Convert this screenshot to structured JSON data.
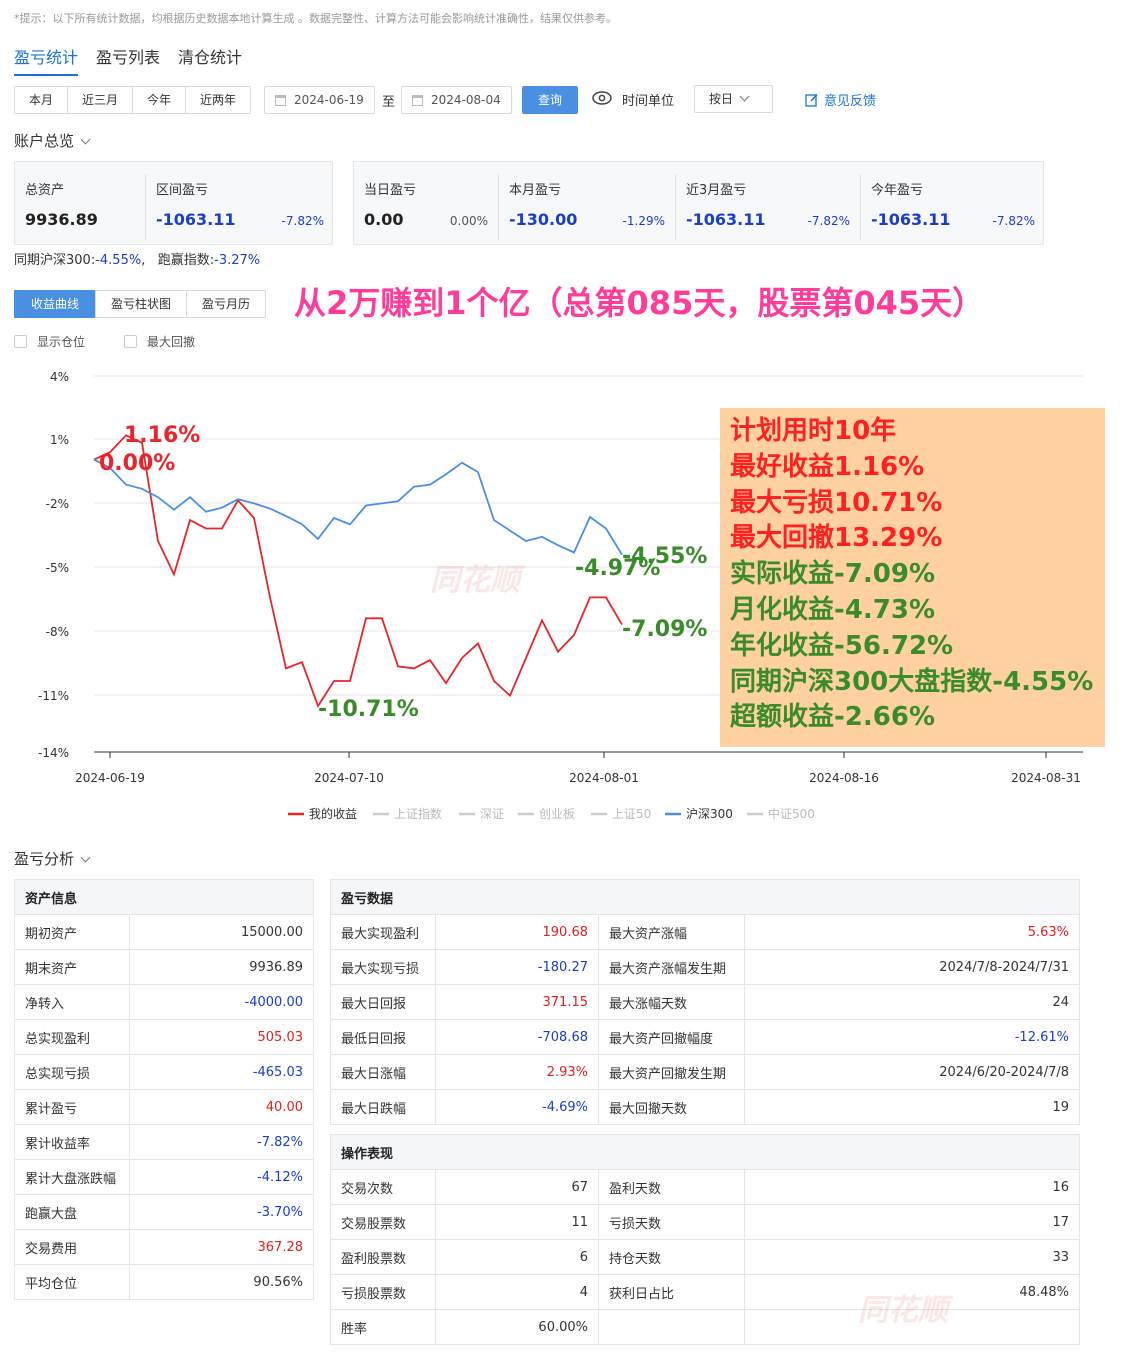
{
  "notice": "*提示：以下所有统计数据，均根据历史数据本地计算生成 。数据完整性、计算方法可能会影响统计准确性，结果仅供参考。",
  "tabs": [
    "盈亏统计",
    "盈亏列表",
    "清仓统计"
  ],
  "periods": [
    "本月",
    "近三月",
    "今年",
    "近两年"
  ],
  "filter": {
    "start_date": "2024-06-19",
    "to": "至",
    "end_date": "2024-08-04",
    "query": "查询",
    "time_unit_label": "时间单位",
    "time_unit_value": "按日",
    "feedback": "意见反馈"
  },
  "overview": {
    "title": "账户总览",
    "total_assets_label": "总资产",
    "total_assets": "9936.89",
    "range_pl_label": "区间盈亏",
    "range_pl": "-1063.11",
    "range_pl_pct": "-7.82%",
    "day_pl_label": "当日盈亏",
    "day_pl": "0.00",
    "day_pl_pct": "0.00%",
    "month_pl_label": "本月盈亏",
    "month_pl": "-130.00",
    "month_pl_pct": "-1.29%",
    "q3_pl_label": "近3月盈亏",
    "q3_pl": "-1063.11",
    "q3_pl_pct": "-7.82%",
    "year_pl_label": "今年盈亏",
    "year_pl": "-1063.11",
    "year_pl_pct": "-7.82%",
    "compare_hs300_label": "同期沪深300:",
    "compare_hs300": "-4.55%",
    "beat_label": "跑赢指数:",
    "beat": "-3.27%"
  },
  "chart_tabs": [
    "收益曲线",
    "盈亏柱状图",
    "盈亏月历"
  ],
  "headline": "从2万赚到1个亿（总第085天，股票第045天）",
  "checkboxes": [
    "显示仓位",
    "最大回撤"
  ],
  "info_lines": [
    {
      "text": "计划用时10年",
      "color": "#ff2020"
    },
    {
      "text": "最好收益1.16%",
      "color": "#ff2020"
    },
    {
      "text": "最大亏损10.71%",
      "color": "#ff2020"
    },
    {
      "text": "最大回撤13.29%",
      "color": "#ff2020"
    },
    {
      "text": "实际收益-7.09%",
      "color": "#3a8c2a"
    },
    {
      "text": "月化收益-4.73%",
      "color": "#3a8c2a"
    },
    {
      "text": "年化收益-56.72%",
      "color": "#3a8c2a"
    },
    {
      "text": "同期沪深300大盘指数-4.55%",
      "color": "#3a8c2a"
    },
    {
      "text": "超额收益-2.66%",
      "color": "#3a8c2a"
    }
  ],
  "chart_data": {
    "type": "line",
    "y_ticks": [
      "4%",
      "1%",
      "-2%",
      "-5%",
      "-8%",
      "-11%",
      "-14%"
    ],
    "ylim": [
      -14,
      4
    ],
    "x_ticks": [
      "2024-06-19",
      "2024-07-10",
      "2024-08-01",
      "2024-08-16",
      "2024-08-31"
    ],
    "series": [
      {
        "name": "我的收益",
        "color": "#e8252a",
        "values": [
          0.0,
          0.35,
          1.16,
          0.8,
          -3.9,
          -5.5,
          -2.9,
          -3.3,
          -3.3,
          -1.95,
          -2.8,
          -6.6,
          -10.0,
          -9.7,
          -11.8,
          -10.6,
          -10.6,
          -7.6,
          -7.6,
          -9.9,
          -10.0,
          -9.6,
          -10.7,
          -9.5,
          -8.8,
          -10.6,
          -11.3,
          -9.5,
          -7.7,
          -9.2,
          -8.4,
          -6.6,
          -6.6,
          -7.9
        ]
      },
      {
        "name": "沪深300",
        "color": "#4a90e2",
        "values": [
          0.0,
          -0.4,
          -1.2,
          -1.4,
          -1.8,
          -2.4,
          -1.8,
          -2.5,
          -2.3,
          -1.9,
          -2.1,
          -2.35,
          -2.7,
          -3.1,
          -3.8,
          -2.8,
          -3.1,
          -2.2,
          -2.1,
          -2.0,
          -1.3,
          -1.2,
          -0.7,
          -0.15,
          -0.6,
          -2.9,
          -3.4,
          -3.9,
          -3.7,
          -4.1,
          -4.45,
          -2.75,
          -3.3,
          -4.55
        ]
      }
    ],
    "annotations": [
      {
        "text": "1.16%",
        "color": "#e8252a"
      },
      {
        "text": "0.00%",
        "color": "#e8252a"
      },
      {
        "text": "-10.71%",
        "color": "#3a8c2a"
      },
      {
        "text": "-4.97%",
        "color": "#3a8c2a"
      },
      {
        "text": "-4.55%",
        "color": "#3a8c2a"
      },
      {
        "text": "-7.09%",
        "color": "#3a8c2a"
      }
    ],
    "legend": [
      {
        "name": "我的收益",
        "color": "#e8252a",
        "active": true
      },
      {
        "name": "上证指数",
        "color": "#cccccc",
        "active": false
      },
      {
        "name": "深证",
        "color": "#cccccc",
        "active": false
      },
      {
        "name": "创业板",
        "color": "#cccccc",
        "active": false
      },
      {
        "name": "上证50",
        "color": "#cccccc",
        "active": false
      },
      {
        "name": "沪深300",
        "color": "#4a90e2",
        "active": true
      },
      {
        "name": "中证500",
        "color": "#cccccc",
        "active": false
      }
    ]
  },
  "analysis_title": "盈亏分析",
  "asset_info": {
    "header": "资产信息",
    "rows": [
      {
        "k": "期初资产",
        "v": "15000.00",
        "c": ""
      },
      {
        "k": "期末资产",
        "v": "9936.89",
        "c": ""
      },
      {
        "k": "净转入",
        "v": "-4000.00",
        "c": "negc"
      },
      {
        "k": "总实现盈利",
        "v": "505.03",
        "c": "pos"
      },
      {
        "k": "总实现亏损",
        "v": "-465.03",
        "c": "negc"
      },
      {
        "k": "累计盈亏",
        "v": "40.00",
        "c": "pos"
      },
      {
        "k": "累计收益率",
        "v": "-7.82%",
        "c": "negc"
      },
      {
        "k": "累计大盘涨跌幅",
        "v": "-4.12%",
        "c": "negc"
      },
      {
        "k": "跑赢大盘",
        "v": "-3.70%",
        "c": "negc"
      },
      {
        "k": "交易费用",
        "v": "367.28",
        "c": "pos"
      },
      {
        "k": "平均仓位",
        "v": "90.56%",
        "c": ""
      }
    ]
  },
  "pl_data": {
    "header": "盈亏数据",
    "rows": [
      {
        "k1": "最大实现盈利",
        "v1": "190.68",
        "c1": "pos",
        "k2": "最大资产涨幅",
        "v2": "5.63%",
        "c2": "pos"
      },
      {
        "k1": "最大实现亏损",
        "v1": "-180.27",
        "c1": "negc",
        "k2": "最大资产涨幅发生期",
        "v2": "2024/7/8-2024/7/31",
        "c2": ""
      },
      {
        "k1": "最大日回报",
        "v1": "371.15",
        "c1": "pos",
        "k2": "最大涨幅天数",
        "v2": "24",
        "c2": ""
      },
      {
        "k1": "最低日回报",
        "v1": "-708.68",
        "c1": "negc",
        "k2": "最大资产回撤幅度",
        "v2": "-12.61%",
        "c2": "negc"
      },
      {
        "k1": "最大日涨幅",
        "v1": "2.93%",
        "c1": "pos",
        "k2": "最大资产回撤发生期",
        "v2": "2024/6/20-2024/7/8",
        "c2": ""
      },
      {
        "k1": "最大日跌幅",
        "v1": "-4.69%",
        "c1": "negc",
        "k2": "最大回撤天数",
        "v2": "19",
        "c2": ""
      }
    ]
  },
  "operation": {
    "header": "操作表现",
    "rows": [
      {
        "k1": "交易次数",
        "v1": "67",
        "k2": "盈利天数",
        "v2": "16"
      },
      {
        "k1": "交易股票数",
        "v1": "11",
        "k2": "亏损天数",
        "v2": "17"
      },
      {
        "k1": "盈利股票数",
        "v1": "6",
        "k2": "持仓天数",
        "v2": "33"
      },
      {
        "k1": "亏损股票数",
        "v1": "4",
        "k2": "获利日占比",
        "v2": "48.48%"
      },
      {
        "k1": "胜率",
        "v1": "60.00%",
        "k2": "",
        "v2": ""
      }
    ]
  },
  "watermark": "同花顺"
}
